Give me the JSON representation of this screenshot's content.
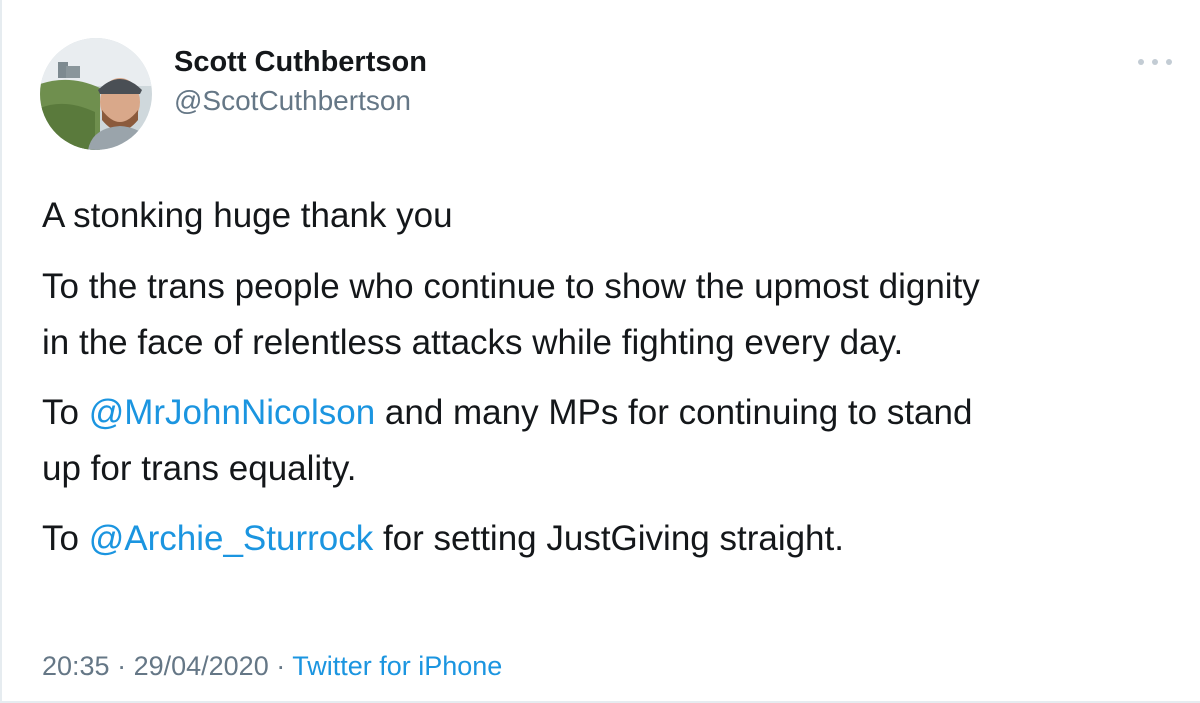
{
  "author": {
    "display_name": "Scott Cuthbertson",
    "handle": "@ScotCuthbertson",
    "avatar_icon": "profile-photo"
  },
  "menu": {
    "icon": "more-dots-icon"
  },
  "tweet": {
    "line1": "A stonking huge thank you",
    "para2_line1": "To the trans people who continue to show the upmost dignity",
    "para2_line2": "in the face of relentless attacks while fighting every day.",
    "para3_prefix": "To ",
    "para3_mention": "@MrJohnNicolson",
    "para3_rest_line1": " and many MPs for continuing to stand",
    "para3_line2": "up for trans equality.",
    "para4_prefix": "To ",
    "para4_mention": "@Archie_Sturrock",
    "para4_rest": " for setting JustGiving straight."
  },
  "meta": {
    "time": "20:35",
    "separator": " · ",
    "date": "29/04/2020",
    "source": "Twitter for iPhone"
  },
  "colors": {
    "text": "#14171a",
    "secondary": "#657786",
    "link": "#1b95e0"
  }
}
